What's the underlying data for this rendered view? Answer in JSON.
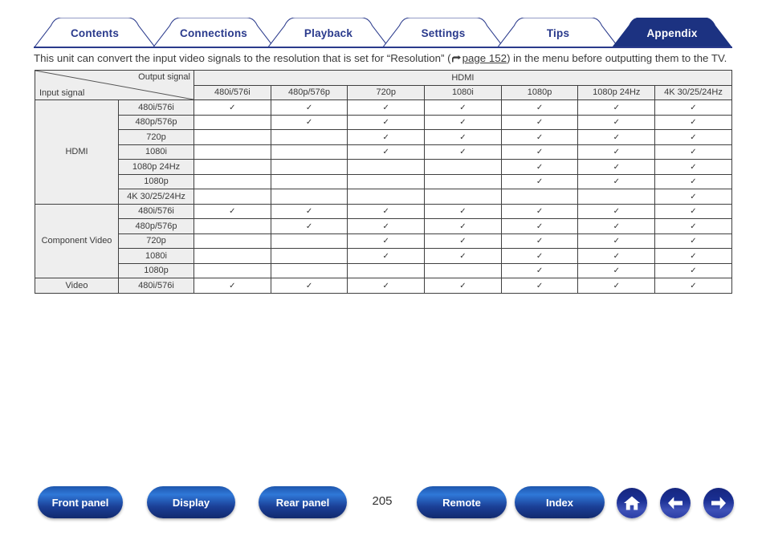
{
  "tabs": [
    {
      "label": "Contents",
      "active": false
    },
    {
      "label": "Connections",
      "active": false
    },
    {
      "label": "Playback",
      "active": false
    },
    {
      "label": "Settings",
      "active": false
    },
    {
      "label": "Tips",
      "active": false
    },
    {
      "label": "Appendix",
      "active": true
    }
  ],
  "intro": {
    "before_link": "This unit can convert the input video signals to the resolution that is set for “Resolution” (",
    "link_text": "page 152",
    "after_link": ") in the menu before outputting them to the TV."
  },
  "table": {
    "corner": {
      "output_label": "Output signal",
      "input_label": "Input signal"
    },
    "group_header": "HDMI",
    "columns": [
      "480i/576i",
      "480p/576p",
      "720p",
      "1080i",
      "1080p",
      "1080p 24Hz",
      "4K 30/25/24Hz"
    ],
    "check_glyph": "✓",
    "groups": [
      {
        "name": "HDMI",
        "rows": [
          {
            "label": "480i/576i",
            "checks": [
              true,
              true,
              true,
              true,
              true,
              true,
              true
            ]
          },
          {
            "label": "480p/576p",
            "checks": [
              false,
              true,
              true,
              true,
              true,
              true,
              true
            ]
          },
          {
            "label": "720p",
            "checks": [
              false,
              false,
              true,
              true,
              true,
              true,
              true
            ]
          },
          {
            "label": "1080i",
            "checks": [
              false,
              false,
              true,
              true,
              true,
              true,
              true
            ]
          },
          {
            "label": "1080p 24Hz",
            "checks": [
              false,
              false,
              false,
              false,
              true,
              true,
              true
            ]
          },
          {
            "label": "1080p",
            "checks": [
              false,
              false,
              false,
              false,
              true,
              true,
              true
            ]
          },
          {
            "label": "4K 30/25/24Hz",
            "checks": [
              false,
              false,
              false,
              false,
              false,
              false,
              true
            ]
          }
        ]
      },
      {
        "name": "Component Video",
        "rows": [
          {
            "label": "480i/576i",
            "checks": [
              true,
              true,
              true,
              true,
              true,
              true,
              true
            ]
          },
          {
            "label": "480p/576p",
            "checks": [
              false,
              true,
              true,
              true,
              true,
              true,
              true
            ]
          },
          {
            "label": "720p",
            "checks": [
              false,
              false,
              true,
              true,
              true,
              true,
              true
            ]
          },
          {
            "label": "1080i",
            "checks": [
              false,
              false,
              true,
              true,
              true,
              true,
              true
            ]
          },
          {
            "label": "1080p",
            "checks": [
              false,
              false,
              false,
              false,
              true,
              true,
              true
            ]
          }
        ]
      },
      {
        "name": "Video",
        "rows": [
          {
            "label": "480i/576i",
            "checks": [
              true,
              true,
              true,
              true,
              true,
              true,
              true
            ]
          }
        ]
      }
    ]
  },
  "bottom_nav": {
    "buttons": [
      {
        "label": "Front panel"
      },
      {
        "label": "Display"
      },
      {
        "label": "Rear panel"
      },
      {
        "label": "Remote"
      },
      {
        "label": "Index"
      }
    ],
    "page_number": "205",
    "icons": [
      {
        "name": "home-icon"
      },
      {
        "name": "back-arrow-icon"
      },
      {
        "name": "forward-arrow-icon"
      }
    ]
  },
  "colors": {
    "tab_blue": "#2a3a8c",
    "tab_active_fill": "#1c3281",
    "button_blue": "#1b3f96",
    "header_shade": "#eeeeee"
  }
}
